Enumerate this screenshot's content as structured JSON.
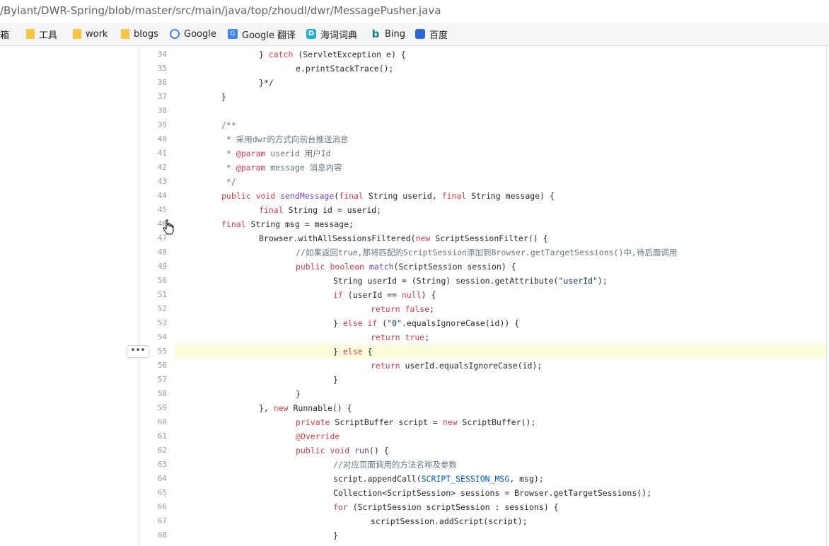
{
  "url": "/Bylant/DWR-Spring/blob/master/src/main/java/top/zhoudl/dwr/MessagePusher.java",
  "bookmarks": [
    {
      "label": "邮箱",
      "icon": "mail-icon"
    },
    {
      "label": "工具",
      "icon": "folder-icon"
    },
    {
      "label": "work",
      "icon": "folder-icon"
    },
    {
      "label": "blogs",
      "icon": "folder-icon"
    },
    {
      "label": "Google",
      "icon": "google-icon"
    },
    {
      "label": "Google 翻译",
      "icon": "google-translate-icon"
    },
    {
      "label": "海词词典",
      "icon": "dict-icon"
    },
    {
      "label": "Bing",
      "icon": "bing-icon"
    },
    {
      "label": "百度",
      "icon": "baidu-icon"
    }
  ],
  "more_button": "•••",
  "code_lines": [
    {
      "n": "34",
      "text": "} catch (ServletException e) {"
    },
    {
      "n": "35",
      "text": "e.printStackTrace();"
    },
    {
      "n": "36",
      "text": "}*/"
    },
    {
      "n": "37",
      "text": "}"
    },
    {
      "n": "38",
      "text": ""
    },
    {
      "n": "39",
      "text": "/**"
    },
    {
      "n": "40",
      "text": " * 采用dwr的方式向前台推送消息"
    },
    {
      "n": "41",
      "text": " * @param userid 用户Id"
    },
    {
      "n": "42",
      "text": " * @param message 消息内容"
    },
    {
      "n": "43",
      "text": " */"
    },
    {
      "n": "44",
      "text": "public void sendMessage(final String userid, final String message) {"
    },
    {
      "n": "45",
      "text": "final String id = userid;"
    },
    {
      "n": "46",
      "text": "final String msg = message;"
    },
    {
      "n": "47",
      "text": "Browser.withAllSessionsFiltered(new ScriptSessionFilter() {"
    },
    {
      "n": "48",
      "text": "//如果返回true,那将匹配的ScriptSession添加到Browser.getTargetSessions()中,待后面调用"
    },
    {
      "n": "49",
      "text": "public boolean match(ScriptSession session) {"
    },
    {
      "n": "50",
      "text": "String userId = (String) session.getAttribute(\"userId\");"
    },
    {
      "n": "51",
      "text": "if (userId == null) {"
    },
    {
      "n": "52",
      "text": "return false;"
    },
    {
      "n": "53",
      "text": "} else if (\"0\".equalsIgnoreCase(id)) {"
    },
    {
      "n": "54",
      "text": "return true;"
    },
    {
      "n": "55",
      "text": "} else {"
    },
    {
      "n": "56",
      "text": "return userId.equalsIgnoreCase(id);"
    },
    {
      "n": "57",
      "text": "}"
    },
    {
      "n": "58",
      "text": "}"
    },
    {
      "n": "59",
      "text": "}, new Runnable() {"
    },
    {
      "n": "60",
      "text": "private ScriptBuffer script = new ScriptBuffer();"
    },
    {
      "n": "61",
      "text": "@Override"
    },
    {
      "n": "62",
      "text": "public void run() {"
    },
    {
      "n": "63",
      "text": "//对应页面调用的方法名称及参数"
    },
    {
      "n": "64",
      "text": "script.appendCall(SCRIPT_SESSION_MSG, msg);"
    },
    {
      "n": "65",
      "text": "Collection<ScriptSession> sessions = Browser.getTargetSessions();"
    },
    {
      "n": "66",
      "text": "for (ScriptSession scriptSession : sessions) {"
    },
    {
      "n": "67",
      "text": "scriptSession.addScript(script);"
    },
    {
      "n": "68",
      "text": "}"
    }
  ]
}
